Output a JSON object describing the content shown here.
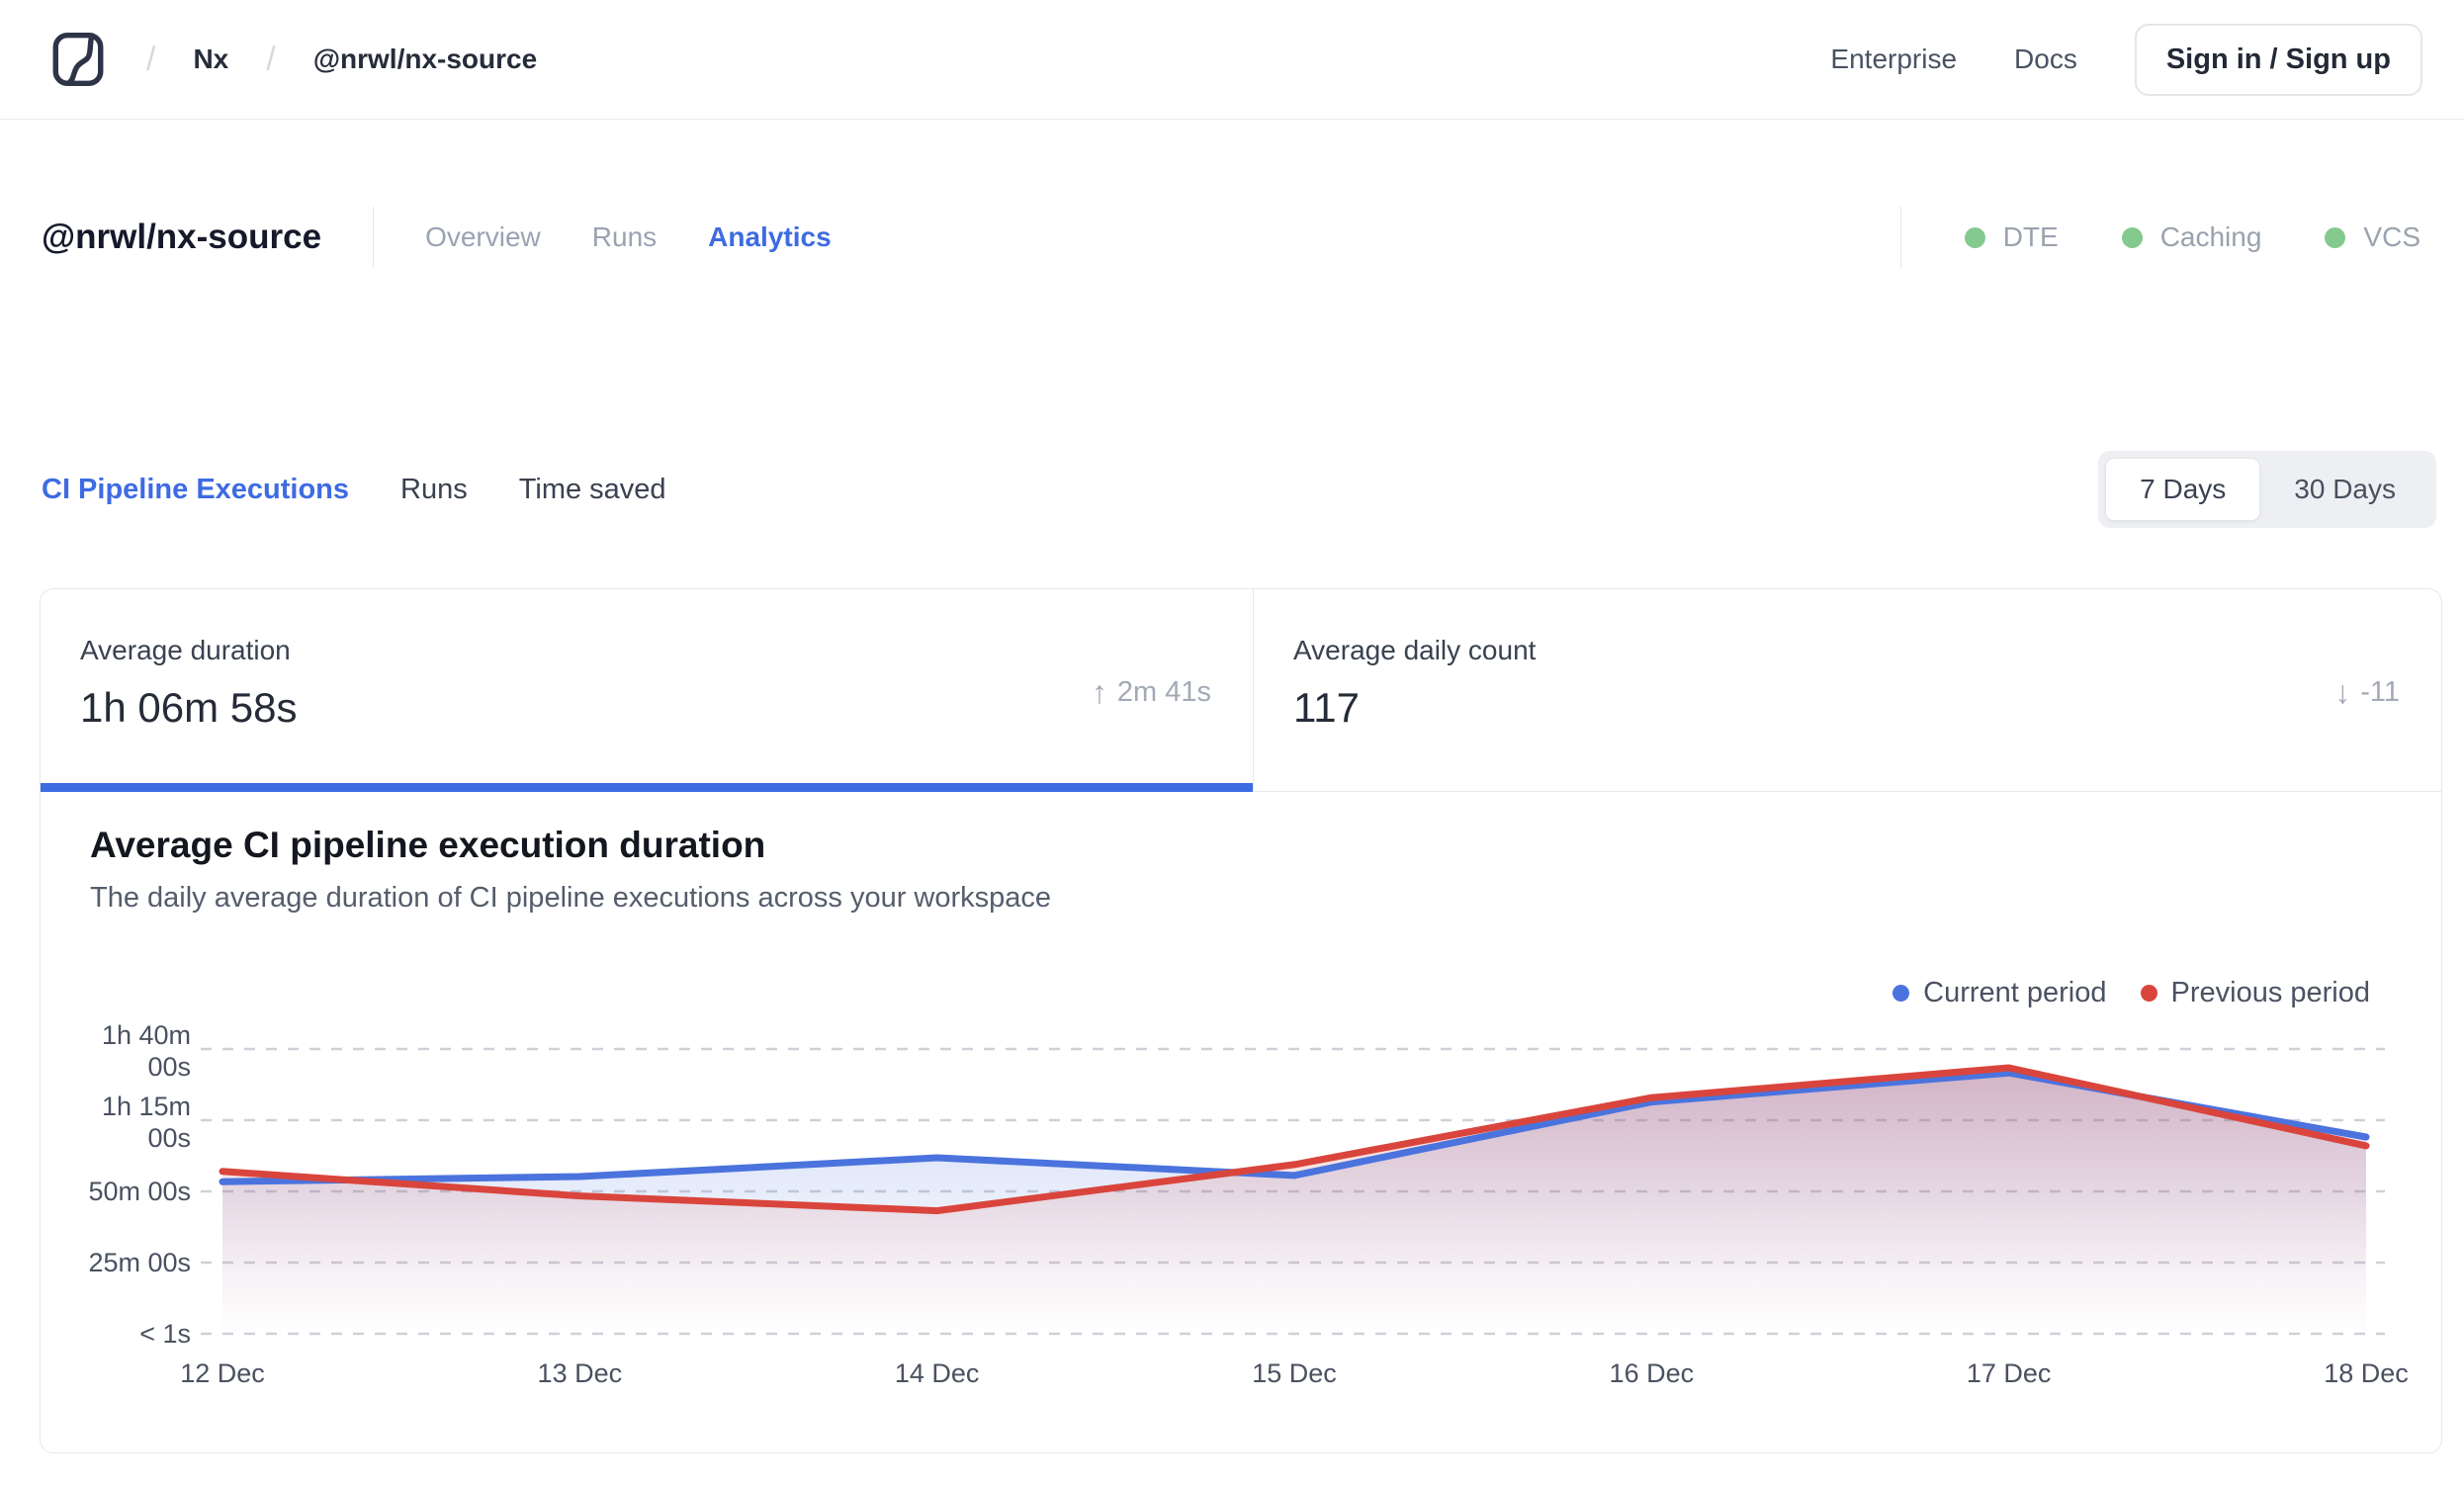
{
  "header": {
    "breadcrumb": {
      "separator": "/",
      "org": "Nx",
      "workspace": "@nrwl/nx-source"
    },
    "links": [
      {
        "label": "Enterprise"
      },
      {
        "label": "Docs"
      }
    ],
    "signin_label": "Sign in / Sign up"
  },
  "workspace": {
    "title": "@nrwl/nx-source",
    "tabs": [
      {
        "label": "Overview",
        "active": false
      },
      {
        "label": "Runs",
        "active": false
      },
      {
        "label": "Analytics",
        "active": true
      }
    ],
    "status": [
      {
        "label": "DTE"
      },
      {
        "label": "Caching"
      },
      {
        "label": "VCS"
      }
    ],
    "status_color": "#84ca8f"
  },
  "analytics": {
    "tabs": [
      {
        "label": "CI Pipeline Executions",
        "active": true
      },
      {
        "label": "Runs",
        "active": false
      },
      {
        "label": "Time saved",
        "active": false
      }
    ],
    "range": {
      "options": [
        "7 Days",
        "30 Days"
      ],
      "selected": "7 Days"
    }
  },
  "stats": [
    {
      "label": "Average duration",
      "value": "1h 06m 58s",
      "delta": "2m 41s",
      "direction": "up",
      "arrow": "↑",
      "active": true
    },
    {
      "label": "Average daily count",
      "value": "117",
      "delta": "-11",
      "direction": "down",
      "arrow": "↓",
      "active": false
    }
  ],
  "chart": {
    "title": "Average CI pipeline execution duration",
    "subtitle": "The daily average duration of CI pipeline executions across your workspace"
  },
  "chart_data": {
    "type": "area",
    "title": "Average CI pipeline execution duration",
    "categories": [
      "12 Dec",
      "13 Dec",
      "14 Dec",
      "15 Dec",
      "16 Dec",
      "17 Dec",
      "18 Dec"
    ],
    "series": [
      {
        "name": "Current period",
        "color": "#4b73dd",
        "unit": "minutes",
        "values": [
          53.4,
          55.2,
          61.8,
          55.6,
          81.4,
          91.6,
          69.1
        ]
      },
      {
        "name": "Previous period",
        "color": "#d9453c",
        "unit": "minutes",
        "values": [
          57.0,
          48.4,
          43.2,
          59.4,
          82.9,
          93.4,
          66.0
        ]
      }
    ],
    "ylim": [
      0,
      100
    ],
    "yticks": [
      {
        "value": 0,
        "label": "< 1s"
      },
      {
        "value": 25,
        "label": "25m 00s"
      },
      {
        "value": 50,
        "label": "50m 00s"
      },
      {
        "value": 75,
        "label": "1h 15m 00s"
      },
      {
        "value": 100,
        "label": "1h 40m 00s"
      }
    ],
    "grid": "dashed",
    "legend_position": "top-right",
    "legend": [
      {
        "label": "Current period",
        "color": "#4b73dd"
      },
      {
        "label": "Previous period",
        "color": "#d9453c"
      }
    ]
  }
}
